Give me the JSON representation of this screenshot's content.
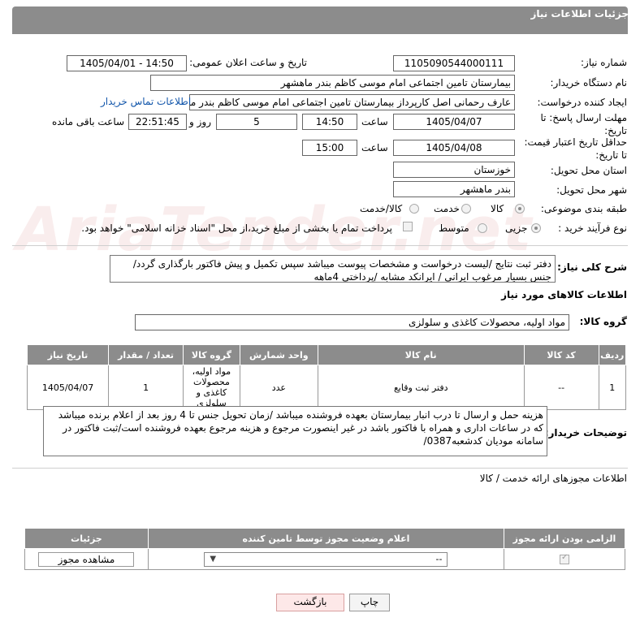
{
  "panel": {
    "title": "جزئیات اطلاعات نیاز"
  },
  "fields": {
    "need_number_label": "شماره نیاز:",
    "need_number": "1105090544000111",
    "announce_label": "تاریخ و ساعت اعلان عمومی:",
    "announce_value": "1405/04/01 - 14:50",
    "buyer_org_label": "نام دستگاه خریدار:",
    "buyer_org": "بیمارستان تامین اجتماعی امام موسی کاظم بندر ماهشهر",
    "requester_label": "ایجاد کننده درخواست:",
    "requester": "عارف رحمانی اصل کارپرداز بیمارستان تامین اجتماعی امام موسی کاظم بندر ماهشهر",
    "contact_link": "اطلاعات تماس خریدار",
    "deadline_label": "مهلت ارسال پاسخ: تا تاریخ:",
    "deadline_date": "1405/04/07",
    "time_word": "ساعت",
    "deadline_time": "14:50",
    "days_value": "5",
    "days_word": "روز و",
    "remaining_time": "22:51:45",
    "remaining_word": "ساعت باقی مانده",
    "validity_label": "حداقل تاریخ اعتبار قیمت: تا تاریخ:",
    "validity_date": "1405/04/08",
    "validity_time": "15:00",
    "province_label": "استان محل تحویل:",
    "province": "خوزستان",
    "city_label": "شهر محل تحویل:",
    "city": "بندر ماهشهر",
    "category_label": "طبقه بندی موضوعی:",
    "category_options": [
      "کالا",
      "خدمت",
      "کالا/خدمت"
    ],
    "purchase_label": "نوع فرآیند خرید :",
    "purchase_options": [
      "جزیی",
      "متوسط"
    ],
    "treasury_text": "پرداخت تمام یا بخشی از مبلغ خرید،از محل \"اسناد خزانه اسلامی\" خواهد بود."
  },
  "description": {
    "label": "شرح کلی نیاز:",
    "text": "دفتر ثبت نتایج /لیست درخواست و مشخصات پیوست میباشد سپس تکمیل و پیش فاکتور بارگذاری گردد/جنس بسیار مرغوب ایرانی / ایرانکد مشابه /پرداختی 4ماهه"
  },
  "goods_section": {
    "title": "اطلاعات کالاهای مورد نیاز",
    "group_label": "گروه کالا:",
    "group_value": "مواد اولیه، محصولات کاغذی و سلولزی"
  },
  "goods_table": {
    "headers": [
      "ردیف",
      "کد کالا",
      "نام کالا",
      "واحد شمارش",
      "گروه کالا",
      "تعداد / مقدار",
      "تاریخ نیاز"
    ],
    "rows": [
      {
        "row": "1",
        "code": "--",
        "name": "دفتر ثبت وقایع",
        "unit": "عدد",
        "group": "مواد اولیه، محصولات کاغذی و سلولزی",
        "qty": "1",
        "date": "1405/04/07"
      }
    ]
  },
  "buyer_notes": {
    "label": "توضیحات خریدار:",
    "text": "هزینه حمل و ارسال تا درب انبار بیمارستان بعهده فروشنده میباشد /زمان تحویل جنس تا 4 روز بعد از اعلام برنده میباشد که در ساعات اداری و همراه با فاکتور باشد در غیر اینصورت مرجوع و هزینه مرجوع بعهده فروشنده است/ثبت فاکتور در سامانه مودیان کدشعبه0387/"
  },
  "permits": {
    "title": "اطلاعات مجوزهای ارائه خدمت / کالا",
    "headers": [
      "الزامی بودن ارائه مجوز",
      "اعلام وضعیت مجوز توسط تامین کننده",
      "جزئیات"
    ],
    "select_value": "--",
    "view_button": "مشاهده مجوز"
  },
  "buttons": {
    "print": "چاپ",
    "back": "بازگشت"
  },
  "watermark": "AriaTender.net",
  "colors": {
    "header": "#8c8c8c",
    "link": "#1155aa",
    "back_button": "#fde8e8"
  }
}
